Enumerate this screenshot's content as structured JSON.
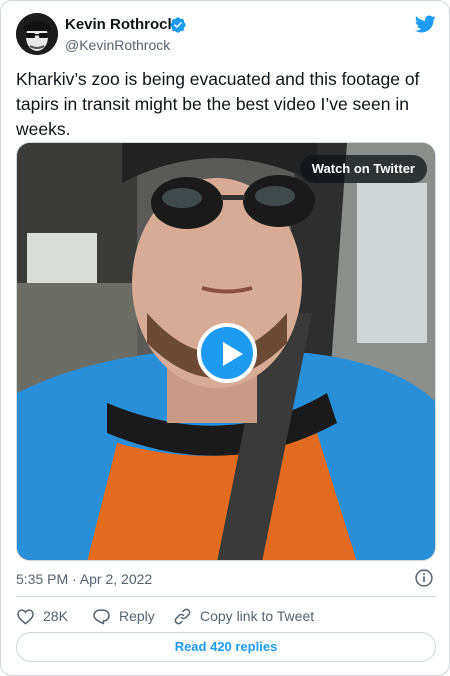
{
  "author": {
    "name": "Kevin Rothrock",
    "handle": "@KevinRothrock"
  },
  "tweet": {
    "text": "Kharkiv’s zoo is being evacuated and this footage of tapirs in transit might be the best video I’ve seen in weeks.",
    "timestamp": "5:35 PM · Apr 2, 2022"
  },
  "video": {
    "watch_label": "Watch on Twitter"
  },
  "actions": {
    "likes": "28K",
    "reply_label": "Reply",
    "copy_label": "Copy link to Tweet"
  },
  "read_replies_label": "Read 420 replies",
  "icons": {
    "verified": "verified-badge-icon",
    "brand": "twitter-bird-icon",
    "play": "play-icon",
    "info": "info-icon",
    "like": "heart-icon",
    "reply": "speech-bubble-icon",
    "copy": "link-icon"
  },
  "colors": {
    "accent": "#1d9bf0",
    "text": "#0f1419",
    "muted": "#536471",
    "border": "#cfd9de"
  }
}
